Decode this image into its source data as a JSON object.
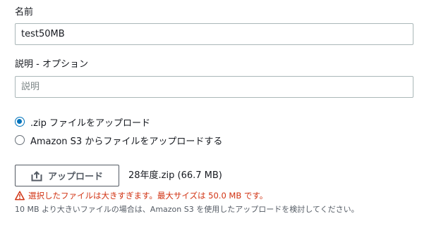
{
  "name_field": {
    "label": "名前",
    "value": "test50MB"
  },
  "description_field": {
    "label": "説明 - オプション",
    "value": "",
    "placeholder": "説明"
  },
  "upload_options": {
    "selected_index": 0,
    "options": [
      {
        "label": ".zip ファイルをアップロード",
        "checked": true
      },
      {
        "label": "Amazon S3 からファイルをアップロードする",
        "checked": false
      }
    ]
  },
  "upload": {
    "button_label": "アップロード",
    "button_icon": "upload-icon",
    "file_name": "28年度.zip (66.7 MB)"
  },
  "validation": {
    "error_icon": "warning-icon",
    "error_message": "選択したファイルは大きすぎます。最大サイズは 50.0 MB です。",
    "hint": "10 MB より大きいファイルの場合は、Amazon S3 を使用したアップロードを検討してください。"
  },
  "colors": {
    "accent": "#0073bb",
    "error": "#d13212",
    "text": "#16191f",
    "secondary_text": "#545b64",
    "border": "#aab7b8"
  }
}
